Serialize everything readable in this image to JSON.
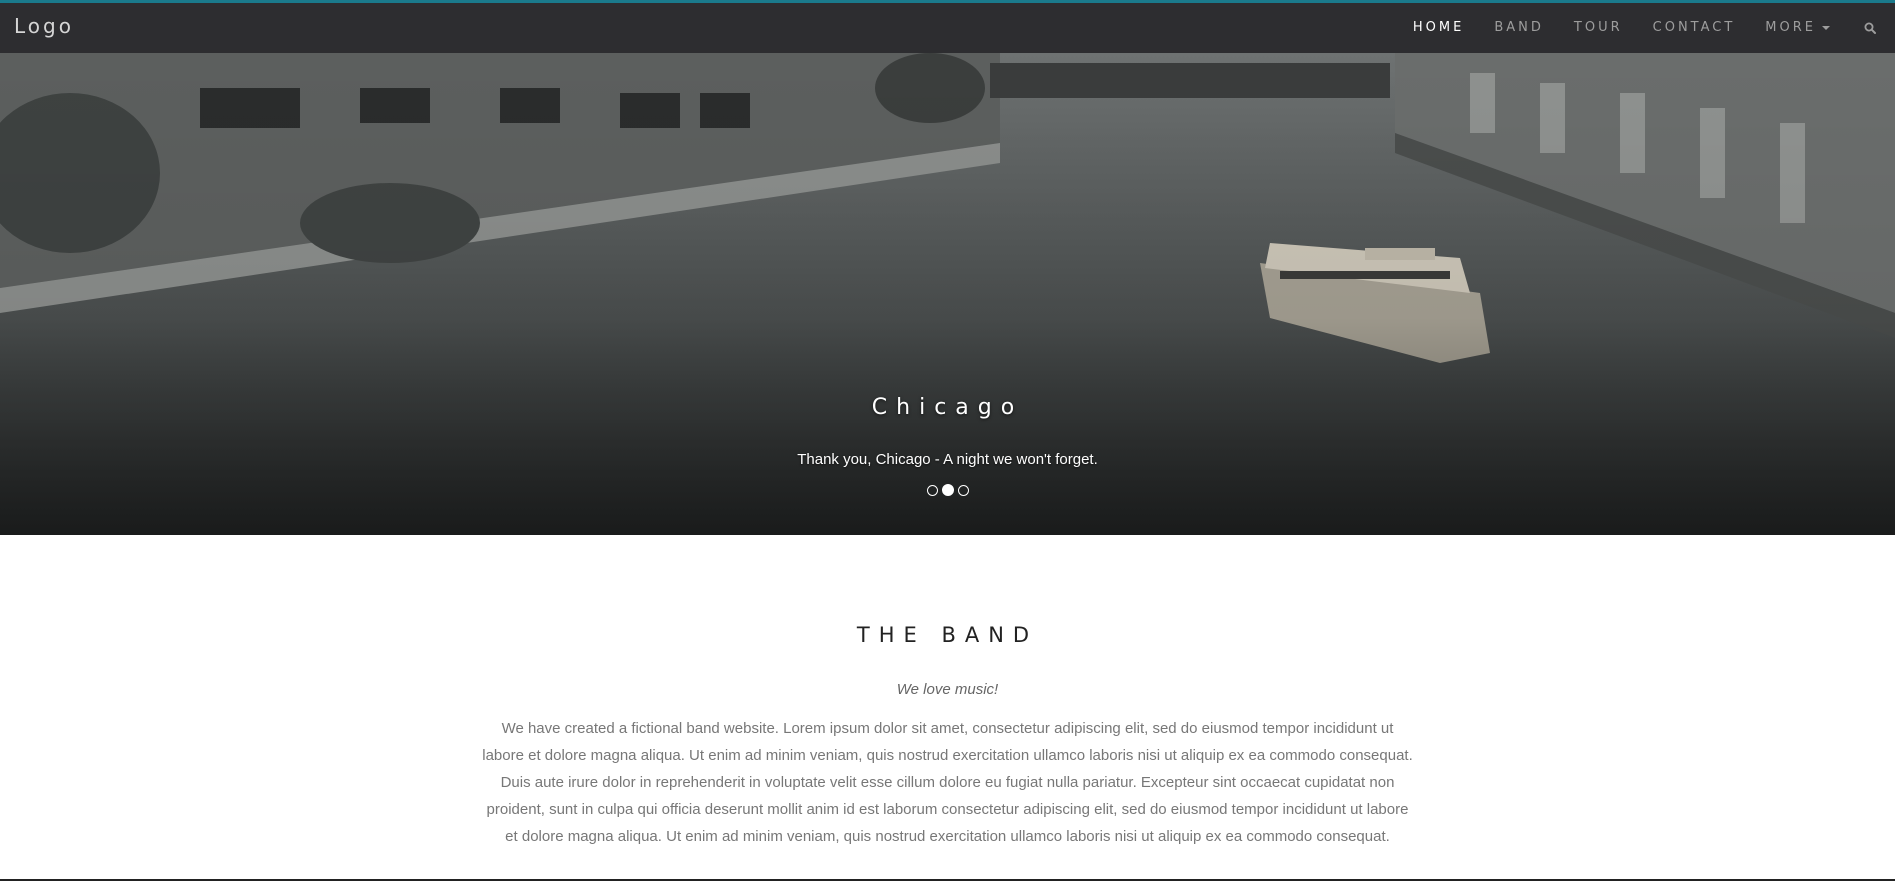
{
  "navbar": {
    "logo": "Logo",
    "links": [
      "HOME",
      "BAND",
      "TOUR",
      "CONTACT"
    ],
    "more_label": "MORE",
    "active": "HOME",
    "icons": {
      "search": "search-icon",
      "caret": "caret-down-icon"
    },
    "colors": {
      "background": "#2d2d30",
      "accent": "#1a7a8c",
      "link": "#9d9d9d",
      "active_link": "#ffffff"
    }
  },
  "hero": {
    "caption_title": "Chicago",
    "caption_text": "Thank you, Chicago - A night we won't forget.",
    "slides": 3,
    "active_slide": 2,
    "image": "chicago-river-boat-grayscale"
  },
  "band": {
    "title": "THE BAND",
    "subtitle": "We love music!",
    "body": "We have created a fictional band website. Lorem ipsum dolor sit amet, consectetur adipiscing elit, sed do eiusmod tempor incididunt ut labore et dolore magna aliqua. Ut enim ad minim veniam, quis nostrud exercitation ullamco laboris nisi ut aliquip ex ea commodo consequat. Duis aute irure dolor in reprehenderit in voluptate velit esse cillum dolore eu fugiat nulla pariatur. Excepteur sint occaecat cupidatat non proident, sunt in culpa qui officia deserunt mollit anim id est laborum consectetur adipiscing elit, sed do eiusmod tempor incididunt ut labore et dolore magna aliqua. Ut enim ad minim veniam, quis nostrud exercitation ullamco laboris nisi ut aliquip ex ea commodo consequat."
  }
}
